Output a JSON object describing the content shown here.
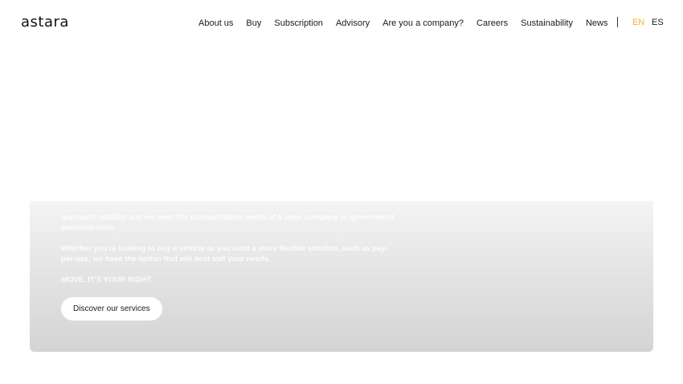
{
  "header": {
    "logo_text": "astara",
    "nav": [
      "About us",
      "Buy",
      "Subscription",
      "Advisory",
      "Are you a company?",
      "Careers",
      "Sustainability",
      "News"
    ],
    "languages": [
      {
        "code": "EN",
        "active": true
      },
      {
        "code": "ES",
        "active": false
      }
    ]
  },
  "hero": {
    "paragraph_1": "approach mobility and we meet the transportation needs of a large company or government administration.",
    "paragraph_2": "Whether you're looking to buy a vehicle or you want a more flexible solution, such as pay-per-use, we have the option that will best suit your needs.",
    "tagline": "MOVE. IT'S YOUR RIGHT.",
    "cta_label": "Discover our services"
  },
  "colors": {
    "accent": "#f2b233",
    "text": "#1a1a1a",
    "hero_gradient_top": "#f4f4f4",
    "hero_gradient_bottom": "#d4d4d4"
  }
}
